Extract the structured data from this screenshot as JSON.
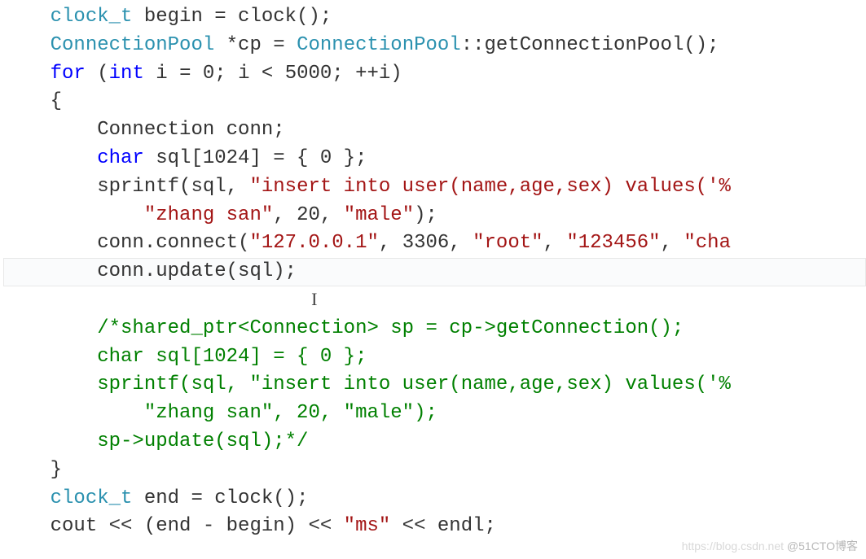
{
  "code": {
    "l1": {
      "indent": "    ",
      "a": "clock_t",
      "b": " begin = clock();"
    },
    "l2": {
      "indent": "    ",
      "a": "ConnectionPool",
      "b": " *cp = ",
      "c": "ConnectionPool",
      "d": "::getConnectionPool();"
    },
    "l3": {
      "indent": "    ",
      "kw1": "for",
      "a": " (",
      "kw2": "int",
      "b": " i = 0; i < 5000; ++i)"
    },
    "l4": {
      "indent": "    ",
      "a": "{"
    },
    "l5": {
      "indent": "        ",
      "a": "Connection conn;"
    },
    "l6": {
      "indent": "        ",
      "kw": "char",
      "a": " sql[1024] = { 0 };"
    },
    "l7": {
      "indent": "        ",
      "a": "sprintf(sql, ",
      "s": "\"insert into user(name,age,sex) values('%",
      "tail": ""
    },
    "l8": {
      "indent": "            ",
      "s1": "\"zhang san\"",
      "a": ", 20, ",
      "s2": "\"male\"",
      "b": ");"
    },
    "l9": {
      "indent": "        ",
      "a": "conn.connect(",
      "s1": "\"127.0.0.1\"",
      "b": ", 3306, ",
      "s2": "\"root\"",
      "c": ", ",
      "s3": "\"123456\"",
      "d": ", ",
      "s4": "\"cha"
    },
    "l10": {
      "indent": "        ",
      "a": "conn.update(sql);"
    },
    "l11": {
      "indent": ""
    },
    "l12": {
      "indent": "        ",
      "cmt": "/*shared_ptr<Connection> sp = cp->getConnection();"
    },
    "l13": {
      "indent": "        ",
      "cmt": "char sql[1024] = { 0 };"
    },
    "l14": {
      "indent": "        ",
      "cmt": "sprintf(sql, \"insert into user(name,age,sex) values('%",
      "tail": ""
    },
    "l15": {
      "indent": "            ",
      "cmt": "\"zhang san\", 20, \"male\");"
    },
    "l16": {
      "indent": "        ",
      "cmt": "sp->update(sql);*/"
    },
    "l17": {
      "indent": "    ",
      "a": "}"
    },
    "l18": {
      "indent": "    ",
      "a": "clock_t",
      "b": " end = clock();"
    },
    "l19": {
      "indent": "    ",
      "a": "cout << (end - begin) << ",
      "s": "\"ms\"",
      "b": " << endl;"
    }
  },
  "watermark": {
    "url": "https://blog.csdn.net",
    "site": "@51CTO博客"
  }
}
